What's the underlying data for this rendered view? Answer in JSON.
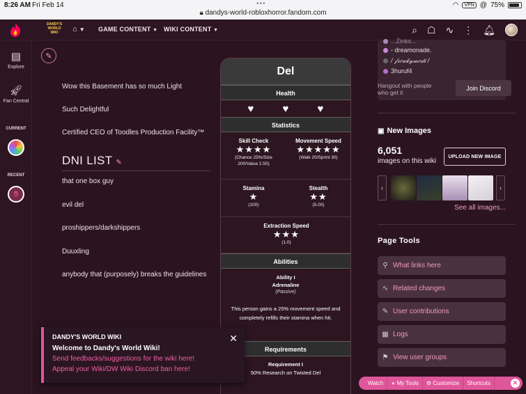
{
  "status_bar": {
    "time": "8:26 AM",
    "date": "Fri Feb 14",
    "url": "dandys-world-robloxhorror.fandom.com",
    "vpn": "VPN",
    "battery": "75%"
  },
  "top_nav": {
    "wiki_logo_text": "DANDY'S WORLD WIKI",
    "items": [
      "GAME CONTENT",
      "WIKI CONTENT"
    ]
  },
  "left_rail": {
    "explore": "Explore",
    "fan_central": "Fan Central",
    "current": "CURRENT",
    "recent": "RECENT"
  },
  "main": {
    "lines": [
      "Wow this Basement has so much Light",
      "Such Delightful",
      "Certified CEO of Toodles Production Facility™"
    ],
    "dni_heading": "DNI LIST",
    "dni_items": [
      "that one box guy",
      "evil del",
      "proshippers/darkshippers",
      "Duuxling",
      "anybody that (purposely) breaks the guidelines"
    ]
  },
  "infobox": {
    "title": "Del",
    "health_header": "Health",
    "statistics_header": "Statistics",
    "skill_check_label": "Skill Check",
    "skill_check_stars": "★★★★",
    "skill_check_sub": "(Chance 25%/Size 200/Value 2.50)",
    "movement_speed_label": "Movement Speed",
    "movement_speed_stars": "★★★★★",
    "movement_speed_sub": "(Walk 20/Sprint 30)",
    "stamina_label": "Stamina",
    "stamina_stars": "★",
    "stamina_sub": "(100)",
    "stealth_label": "Stealth",
    "stealth_stars": "★★",
    "stealth_sub": "(5.00)",
    "extraction_label": "Extraction Speed",
    "extraction_stars": "★★★",
    "extraction_sub": "(1.0)",
    "abilities_header": "Abilities",
    "ability_num": "Ability I",
    "ability_name": "Adrenaline",
    "ability_type": "(Passive)",
    "ability_desc": "This person gains a 25% movement speed and completely refills their stamina when hit.",
    "requirements_header": "Requirements",
    "requirement_num": "Requirement I",
    "requirement_desc": "50% Research on Twisted Del"
  },
  "discord": {
    "names": [
      "...Zinks...",
      "- dreamonade.",
      "/ 𝒻𝓇𝑒𝒶𝓀𝓎𝓂𝑒𝒹𝒾 /",
      "3huruf4"
    ],
    "hangout": "Hangout with people who get it",
    "join": "Join Discord"
  },
  "new_images": {
    "title": "New Images",
    "count": "6,051",
    "sub": "images on this wiki",
    "upload": "UPLOAD NEW IMAGE",
    "see_all": "See all images..."
  },
  "page_tools": {
    "title": "Page Tools",
    "items": [
      "What links here",
      "Related changes",
      "User contributions",
      "Logs",
      "View user groups"
    ]
  },
  "toast": {
    "heading": "DANDY'S WORLD WIKI",
    "welcome": "Welcome to Dandy's World Wiki!",
    "link1": "Send feedbacks/suggestions for the wiki here!",
    "link2": "Appeal your Wiki/DW Wiki Discord ban here!"
  },
  "toolbar": {
    "watch": "Watch",
    "my_tools": "My Tools",
    "customize": "Customize",
    "shortcuts": "Shortcuts"
  },
  "colors": {
    "accent": "#e0569a",
    "background": "#2b1420",
    "link": "#f19abf"
  }
}
